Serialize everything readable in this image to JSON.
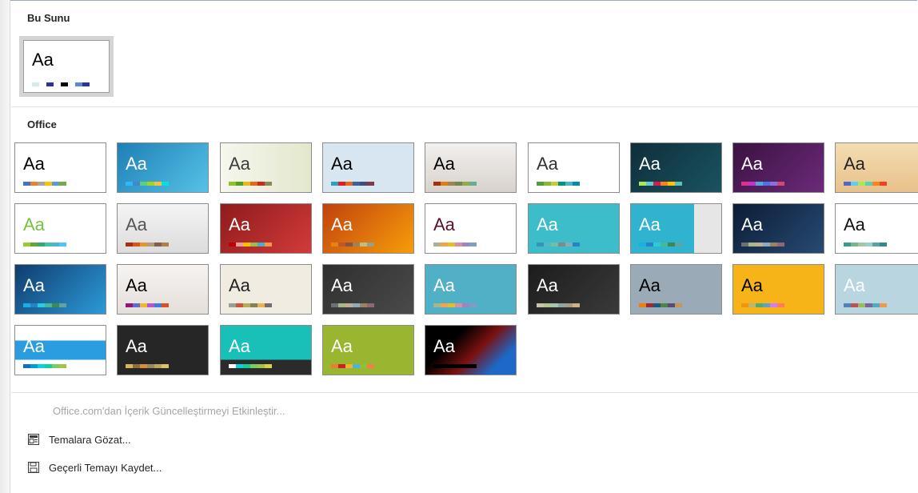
{
  "sections": {
    "current_title": "Bu Sunu",
    "office_title": "Office"
  },
  "current_theme": {
    "aa": "Aa",
    "swatches": [
      "#d6ecec",
      "#ffffff",
      "#2f2f9e",
      "#ffffff",
      "#000000",
      "#ffffff",
      "#5b8bc9",
      "#2f2f9e"
    ]
  },
  "themes": [
    {
      "aa": "Aa",
      "bg": "#ffffff",
      "fg": "#000000",
      "sw": [
        "#4472c4",
        "#ed7d31",
        "#a5a5a5",
        "#ffc000",
        "#5b9bd5",
        "#70ad47"
      ]
    },
    {
      "aa": "Aa",
      "bg": "linear-gradient(135deg,#1e7fb5,#56c2e8)",
      "fg": "#ffffff",
      "sw": [
        "#31b6fd",
        "#4584d3",
        "#5bd078",
        "#a5d028",
        "#f5c040",
        "#05e0db"
      ]
    },
    {
      "aa": "Aa",
      "bg": "linear-gradient(90deg,#f6f6ee,#e2e8cc)",
      "fg": "#3c3c3c",
      "sw": [
        "#90c226",
        "#54a021",
        "#e6b91e",
        "#e76618",
        "#c42f1a",
        "#918655"
      ]
    },
    {
      "aa": "Aa",
      "bg": "#d7e6f1",
      "fg": "#000000",
      "sw": [
        "#2da2bf",
        "#da1f28",
        "#eb641b",
        "#39639d",
        "#474b78",
        "#7d3c4a"
      ]
    },
    {
      "aa": "Aa",
      "bg": "linear-gradient(180deg,#f2f0ee,#d8d2cc)",
      "fg": "#000000",
      "sw": [
        "#a53010",
        "#de7e18",
        "#9f8351",
        "#728653",
        "#92aa4c",
        "#6aac91"
      ]
    },
    {
      "aa": "Aa",
      "bg": "#ffffff",
      "fg": "#333333",
      "sw": [
        "#549e39",
        "#8ab833",
        "#c0cf3a",
        "#029676",
        "#4ab5c4",
        "#0989b1"
      ]
    },
    {
      "aa": "Aa",
      "bg": "linear-gradient(135deg,#0f2e3a,#1a5360)",
      "fg": "#ffffff",
      "sw": [
        "#a7ea52",
        "#5ecccf",
        "#cc2052",
        "#ff8021",
        "#ffc400",
        "#5fc1b3"
      ]
    },
    {
      "aa": "Aa",
      "bg": "linear-gradient(135deg,#3a1240,#6b2a7a)",
      "fg": "#ffffff",
      "sw": [
        "#e32d91",
        "#c830cc",
        "#4ea6dc",
        "#4775e7",
        "#8971e1",
        "#d54773"
      ]
    },
    {
      "aa": "Aa",
      "bg": "linear-gradient(180deg,#f3ddb2,#e8c18a)",
      "fg": "#222222",
      "sw": [
        "#4e67c8",
        "#5eccf3",
        "#a7ea52",
        "#5dceaf",
        "#ff8021",
        "#f14124"
      ]
    },
    {
      "aa": "Aa",
      "bg": "#ffffff",
      "fg": "#7ac143",
      "sw": [
        "#99cb38",
        "#63a537",
        "#37a76f",
        "#44c1a3",
        "#4eb3cf",
        "#51c3f9"
      ]
    },
    {
      "aa": "Aa",
      "bg": "linear-gradient(180deg,#f4f4f4,#dcdcdc)",
      "fg": "#555555",
      "sw": [
        "#a5300f",
        "#d55816",
        "#e19825",
        "#b19c7d",
        "#7f5f52",
        "#b27d49"
      ]
    },
    {
      "aa": "Aa",
      "bg": "linear-gradient(135deg,#8e1b1b,#d33a3a)",
      "fg": "#ffffff",
      "sw": [
        "#c00000",
        "#e49d9d",
        "#ffc000",
        "#9bbb59",
        "#4bacc6",
        "#f79646"
      ]
    },
    {
      "aa": "Aa",
      "bg": "linear-gradient(135deg,#c2410c,#f59e0b)",
      "fg": "#ffffff",
      "sw": [
        "#e48312",
        "#bd582c",
        "#865640",
        "#9b8357",
        "#c2bc80",
        "#94a088"
      ]
    },
    {
      "aa": "Aa",
      "bg": "#ffffff",
      "fg": "#5a1030",
      "sw": [
        "#a5b592",
        "#f3a447",
        "#e7bc29",
        "#d092a7",
        "#9c85c0",
        "#809ec2"
      ]
    },
    {
      "aa": "Aa",
      "bg": "#3dbcc9",
      "fg": "#ffffff",
      "sw": [
        "#3494ba",
        "#58b6c0",
        "#75bda7",
        "#7a8c8e",
        "#84acb6",
        "#2683c6"
      ]
    },
    {
      "aa": "Aa",
      "bg": "linear-gradient(90deg,#2fb3cf 0%,#2fb3cf 70%,#e6e6e6 70%)",
      "fg": "#ffffff",
      "sw": [
        "#1cade4",
        "#2683c6",
        "#27ced7",
        "#42ba97",
        "#3e8853",
        "#62a39f"
      ]
    },
    {
      "aa": "Aa",
      "bg": "linear-gradient(135deg,#0b1c36,#284a72)",
      "fg": "#ffffff",
      "sw": [
        "#6f6f74",
        "#a7b789",
        "#beae98",
        "#92a9b9",
        "#9c8265",
        "#8d6974"
      ]
    },
    {
      "aa": "Aa",
      "bg": "#ffffff",
      "fg": "#111111",
      "sw": [
        "#3d9b8d",
        "#78b48f",
        "#a3c6a5",
        "#9ad0c7",
        "#5fa1a1",
        "#2f8b89"
      ]
    },
    {
      "aa": "Aa",
      "bg": "linear-gradient(135deg,#0f3c6e,#2c9ad8)",
      "fg": "#ffffff",
      "sw": [
        "#1cade4",
        "#2683c6",
        "#27ced7",
        "#42ba97",
        "#3e8853",
        "#62a39f"
      ]
    },
    {
      "aa": "Aa",
      "bg": "linear-gradient(180deg,#f6f3f1,#e5dfda)",
      "fg": "#000000",
      "sw": [
        "#94147c",
        "#5d6bd7",
        "#f1b829",
        "#b955c9",
        "#3d7be2",
        "#de4d27"
      ]
    },
    {
      "aa": "Aa",
      "bg": "#f0ece2",
      "fg": "#222222",
      "sw": [
        "#93a299",
        "#cf543f",
        "#b5ae53",
        "#848058",
        "#e8b54d",
        "#786c71"
      ]
    },
    {
      "aa": "Aa",
      "bg": "linear-gradient(135deg,#2f2f2f,#4a4a4a)",
      "fg": "#ffffff",
      "sw": [
        "#6f6f74",
        "#a7b789",
        "#beae98",
        "#92a9b9",
        "#9c8265",
        "#8d6974"
      ]
    },
    {
      "aa": "Aa",
      "bg": "#4fb0c6",
      "fg": "#ffffff",
      "sw": [
        "#a5b592",
        "#f3a447",
        "#e7bc29",
        "#d092a7",
        "#9c85c0",
        "#809ec2"
      ]
    },
    {
      "aa": "Aa",
      "bg": "linear-gradient(135deg,#1c1c1c,#3a3a3a)",
      "fg": "#ffffff",
      "sw": [
        "#c6c6a6",
        "#b5c48b",
        "#a6c5b0",
        "#90a7a1",
        "#a89c86",
        "#c9b287"
      ]
    },
    {
      "aa": "Aa",
      "bg": "#9aaab6",
      "fg": "#000000",
      "sw": [
        "#f07f09",
        "#9f2936",
        "#1b587c",
        "#4e8542",
        "#604878",
        "#c19859"
      ]
    },
    {
      "aa": "Aa",
      "bg": "#f6b418",
      "fg": "#000000",
      "sw": [
        "#f09415",
        "#c1b56b",
        "#4baf73",
        "#5aa6c0",
        "#d17df9",
        "#fa7e5c"
      ]
    },
    {
      "aa": "Aa",
      "bg": "#b9d6e0",
      "fg": "#ffffff",
      "sw": [
        "#4f81bd",
        "#c0504d",
        "#9bbb59",
        "#8064a2",
        "#4bacc6",
        "#f79646"
      ]
    },
    {
      "aa": "Aa",
      "bg": "linear-gradient(180deg,#ffffff 0%,#ffffff 30%,#2a9de0 30%,#2a9de0 70%,#ffffff 70%)",
      "fg": "#ffffff",
      "sw": [
        "#0f6fc6",
        "#009dd9",
        "#0bd0d9",
        "#10cf9b",
        "#7cca62",
        "#a5c249"
      ]
    },
    {
      "aa": "Aa",
      "bg": "#262626",
      "fg": "#ffffff",
      "sw": [
        "#d8b25c",
        "#8b6d3e",
        "#d88e3a",
        "#9a8b5f",
        "#bfa75a",
        "#e1c06e"
      ]
    },
    {
      "aa": "Aa",
      "bg": "linear-gradient(180deg,#18c0b8 0%,#18c0b8 70%,#2b2b2b 70%)",
      "fg": "#ffffff",
      "sw": [
        "#ffffff",
        "#0bd0d9",
        "#10cf9b",
        "#7cca62",
        "#a5c249",
        "#d7d447"
      ]
    },
    {
      "aa": "Aa",
      "bg": "#9ab52f",
      "fg": "#ffffff",
      "sw": [
        "#e87d37",
        "#c62324",
        "#f0b228",
        "#4bb3e0",
        "#8fbf3f",
        "#f17f43"
      ]
    },
    {
      "aa": "Aa",
      "bg": "linear-gradient(135deg,#000000 30%,#7a1010 55%,#1d68c9 80%)",
      "fg": "#ffffff",
      "sw": [
        "#000000",
        "#000000",
        "#000000",
        "#000000",
        "#000000",
        "#000000"
      ]
    }
  ],
  "commands": {
    "enable_updates": "Office.com'dan İçerik Güncelleştirmeyi Etkinleştir...",
    "browse_themes": "Temalara Gözat...",
    "save_theme": "Geçerli Temayı Kaydet..."
  },
  "icons": {
    "browse": "browse-themes-icon",
    "save": "save-theme-icon"
  }
}
